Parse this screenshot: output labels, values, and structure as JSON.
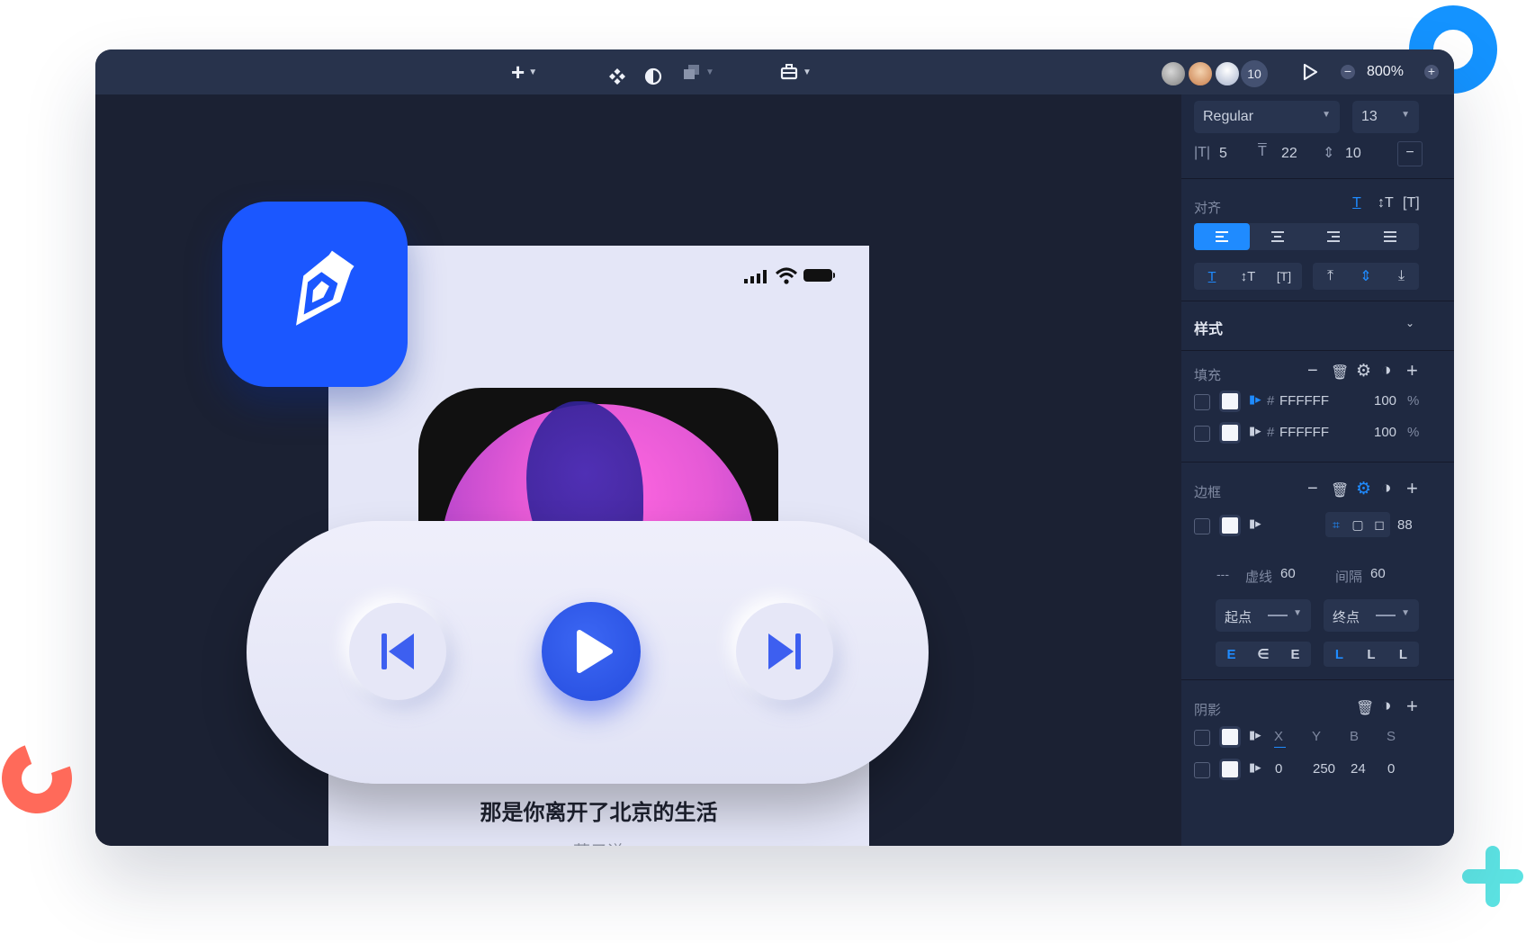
{
  "toolbar": {
    "add_label": "+",
    "collaborator_count": "10",
    "zoom": "800%"
  },
  "panel": {
    "font_weight": "Regular",
    "font_size": "13",
    "letter_spacing": "5",
    "line_height": "22",
    "paragraph_spacing": "10",
    "align_label": "对齐",
    "style_label": "样式",
    "fill_label": "填充",
    "fills": [
      {
        "hash": "#",
        "hex": "FFFFFF",
        "opacity": "100",
        "unit": "%"
      },
      {
        "hash": "#",
        "hex": "FFFFFF",
        "opacity": "100",
        "unit": "%"
      }
    ],
    "border_label": "边框",
    "border_value": "88",
    "dash_label": "虚线",
    "dash_value": "60",
    "gap_label": "间隔",
    "gap_value": "60",
    "start_label": "起点",
    "end_label": "终点",
    "shadow_label": "阴影",
    "shadow_headers": [
      "X",
      "Y",
      "B",
      "S"
    ],
    "shadow_values": [
      "0",
      "250",
      "24",
      "0"
    ]
  },
  "artboard": {
    "song_title": "那是你离开了北京的生活",
    "artist": "薛子谦"
  },
  "colors": {
    "accent": "#1f8bff",
    "app_icon": "#1b57ff",
    "play_button": "#2e57ee",
    "deco_blue_ring": "#1493ff",
    "deco_red_ring": "#ff6a5a",
    "deco_cyan_plus": "#5ce2e2"
  }
}
